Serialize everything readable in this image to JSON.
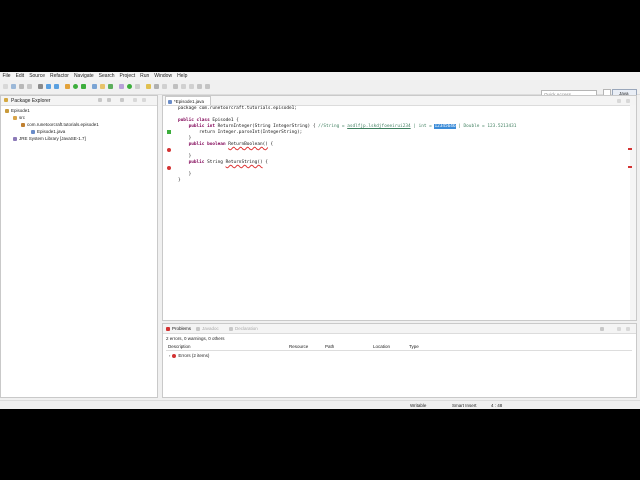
{
  "menu": [
    "File",
    "Edit",
    "Source",
    "Refactor",
    "Navigate",
    "Search",
    "Project",
    "Run",
    "Window",
    "Help"
  ],
  "toolbar": {
    "quick_access_placeholder": "Quick Access",
    "perspective_label": "Java"
  },
  "package_explorer": {
    "title": "Package Explorer",
    "tree": [
      {
        "label": "Episode1",
        "depth": 0
      },
      {
        "label": "src",
        "depth": 1
      },
      {
        "label": "com.runetoorcraft.tutorials.episode1",
        "depth": 2
      },
      {
        "label": "Episode1.java",
        "depth": 3
      },
      {
        "label": "JRE System Library [JavaSE-1.7]",
        "depth": 1
      }
    ]
  },
  "editor": {
    "tab_label": "*Episode1.java",
    "lines": {
      "l1": "package com.runetoorcraft.tutorials.episode1;",
      "l3a": "public class",
      "l3b": " Episode1 {",
      "l4a": "    public int",
      "l4b": " ReturnInteger(String IntegerString) { ",
      "l4c": "//String = ",
      "l4d": "asdlfjp.lskdjfoeeirui234",
      "l4e": " | int = ",
      "l4f": "12345646",
      "l4g": " | Double = 123.5213431",
      "l5": "        return Integer.parseInt(IntegerString);",
      "l6": "    }",
      "l7a": "    public boolean",
      "l7b": " ",
      "l7c": "ReturnBoolean()",
      "l7d": " {",
      "l9": "    }",
      "l10a": "    public",
      "l10b": " String ",
      "l10c": "ReturnString()",
      "l10d": " {",
      "l12": "    }",
      "l13": "}"
    }
  },
  "problems": {
    "tabs": [
      "Problems",
      "Javadoc",
      "Declaration"
    ],
    "summary": "2 errors, 0 warnings, 0 others",
    "columns": [
      "Description",
      "Resource",
      "Path",
      "Location",
      "Type"
    ],
    "rows": [
      {
        "description": "Errors (2 items)"
      }
    ]
  },
  "status": {
    "writable": "Writable",
    "insert": "Smart Insert",
    "position": "4 : 48"
  },
  "colors": {
    "keyword": "#7f0055",
    "comment": "#3f7f5f",
    "selection": "#3c8cd8",
    "error": "#d33333"
  }
}
